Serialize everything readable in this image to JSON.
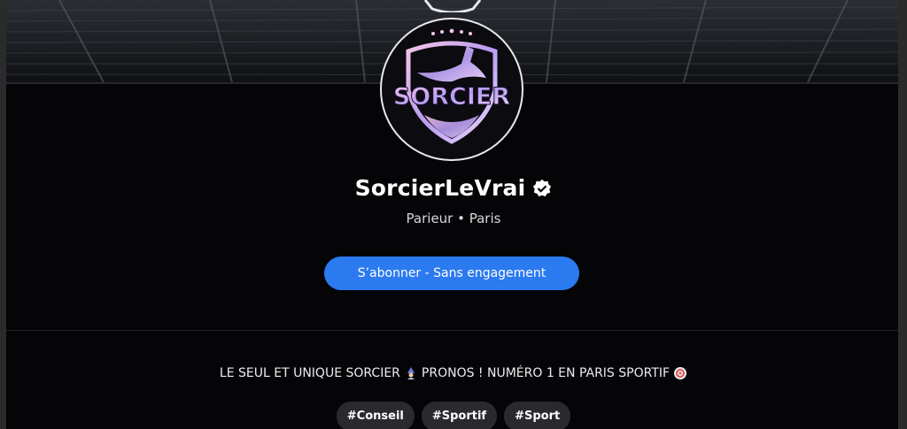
{
  "profile": {
    "name": "SorcierLeVrai",
    "subtitle": "Parieur • Paris",
    "logo_text": "SORCIER",
    "verified_icon": "verified-badge-icon"
  },
  "actions": {
    "subscribe_label": "S’abonner - Sans engagement"
  },
  "bio": {
    "text_before": "LE SEUL ET UNIQUE SORCIER",
    "text_middle": "PRONOS ! NUMÉRO 1 EN PARIS SPORTIF",
    "icon_1": "wizard-emoji-icon",
    "icon_2": "target-emoji-icon"
  },
  "tags": [
    "#Conseil",
    "#Sportif",
    "#Sport"
  ],
  "colors": {
    "background": "#050507",
    "accent": "#2b7af0",
    "tag_bg": "#2a2a2e",
    "logo_gradient": [
      "#f6c5e8",
      "#b69cf0",
      "#f0d6ff"
    ]
  }
}
